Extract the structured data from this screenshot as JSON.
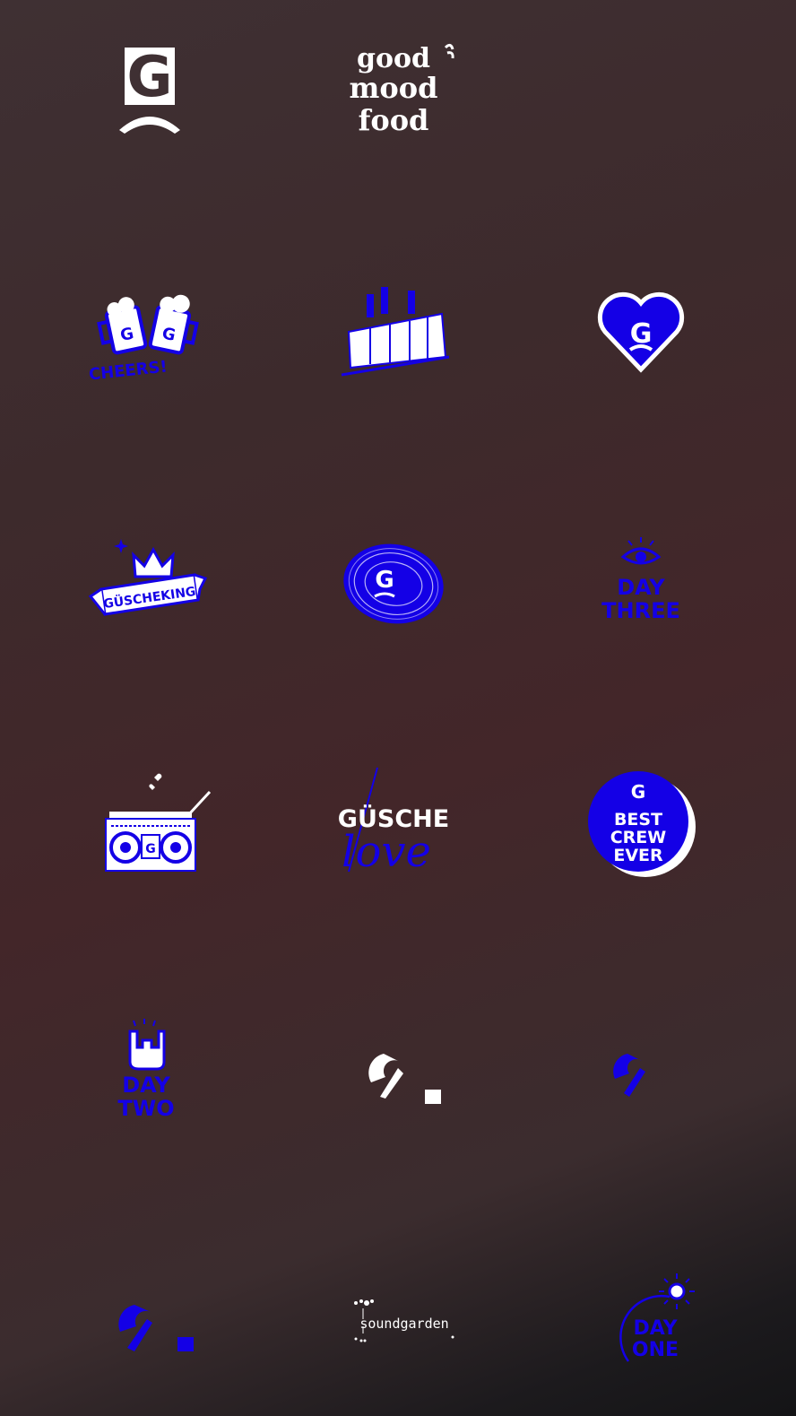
{
  "colors": {
    "accent_blue": "#1400e6",
    "white": "#ffffff",
    "background_top": "#3f3033",
    "background_bottom": "#141416"
  },
  "stickers": {
    "g_logo": {
      "icon": "g-logo-icon",
      "letter": "G"
    },
    "good_mood_food": {
      "line1": "good",
      "line2": "mood",
      "line3": "food"
    },
    "cheers": {
      "icon": "beer-mugs-icon",
      "text": "CHEERS!",
      "letter": "G"
    },
    "train": {
      "icon": "train-car-icon"
    },
    "heart": {
      "icon": "heart-icon",
      "letter": "G"
    },
    "guscheking": {
      "icon": "crown-icon",
      "text": "GÜSCHEKING"
    },
    "fingerprint": {
      "icon": "fingerprint-icon",
      "letter": "G"
    },
    "day_three": {
      "icon": "eye-icon",
      "line1": "DAY",
      "line2": "THREE"
    },
    "boombox": {
      "icon": "boombox-icon",
      "letter": "G"
    },
    "gusche_love": {
      "line1": "GÜSCHE",
      "line2": "love"
    },
    "best_crew_ever": {
      "letter": "G",
      "line1": "BEST",
      "line2": "CREW",
      "line3": "EVER"
    },
    "day_two": {
      "icon": "rock-hand-icon",
      "line1": "DAY",
      "line2": "TWO"
    },
    "partial_logo_white": {
      "icon": "g-arc-icon"
    },
    "partial_logo_blue": {
      "icon": "g-arc-icon"
    },
    "partial_logo_blue_bottom": {
      "icon": "g-arc-icon"
    },
    "soundgarden": {
      "text": "soundgarden"
    },
    "day_one": {
      "icon": "sun-icon",
      "line1": "DAY",
      "line2": "ONE"
    }
  }
}
